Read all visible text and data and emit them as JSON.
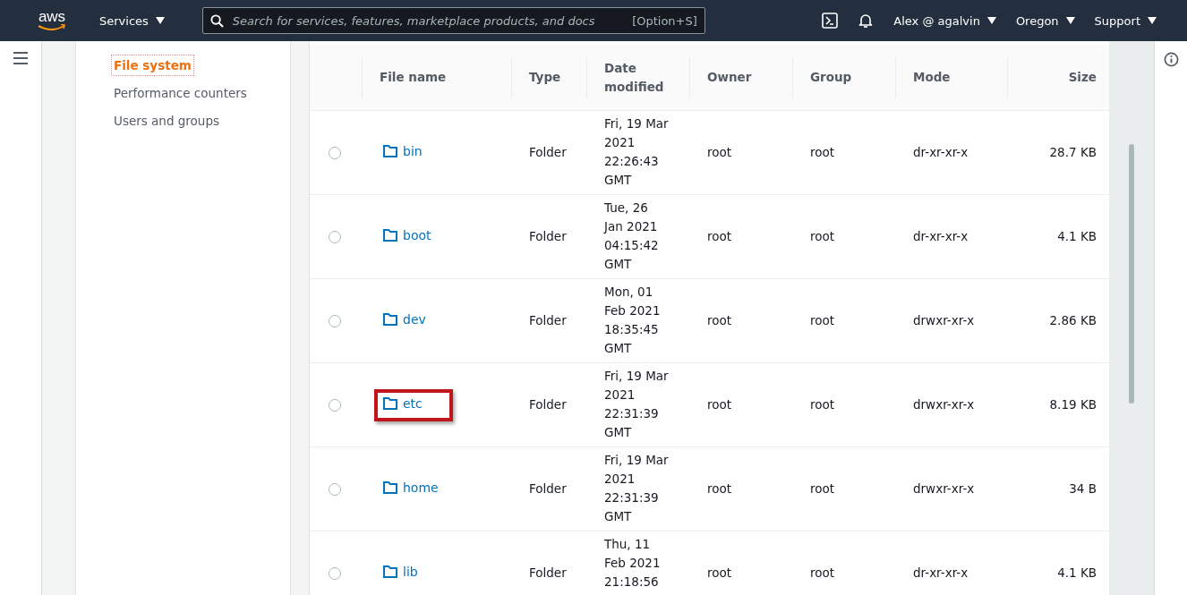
{
  "nav": {
    "logo": "aws",
    "services": "Services",
    "search": {
      "placeholder": "Search for services, features, marketplace products, and docs",
      "shortcut": "[Option+S]"
    },
    "account": "Alex @ agalvin",
    "region": "Oregon",
    "support": "Support"
  },
  "sidebar": {
    "items": [
      {
        "label": "File system",
        "selected": true
      },
      {
        "label": "Performance counters",
        "selected": false
      },
      {
        "label": "Users and groups",
        "selected": false
      }
    ]
  },
  "table": {
    "columns": [
      "File name",
      "Type",
      "Date modified",
      "Owner",
      "Group",
      "Mode",
      "Size"
    ],
    "rows": [
      {
        "selected": false,
        "highlighted": false,
        "name": "bin",
        "type": "Folder",
        "date": [
          "Fri, 19 Mar",
          "2021",
          "22:26:43",
          "GMT"
        ],
        "owner": "root",
        "group": "root",
        "mode": "dr-xr-xr-x",
        "size": "28.7 KB"
      },
      {
        "selected": false,
        "highlighted": false,
        "name": "boot",
        "type": "Folder",
        "date": [
          "Tue, 26",
          "Jan 2021",
          "04:15:42",
          "GMT"
        ],
        "owner": "root",
        "group": "root",
        "mode": "dr-xr-xr-x",
        "size": "4.1 KB"
      },
      {
        "selected": false,
        "highlighted": false,
        "name": "dev",
        "type": "Folder",
        "date": [
          "Mon, 01",
          "Feb 2021",
          "18:35:45",
          "GMT"
        ],
        "owner": "root",
        "group": "root",
        "mode": "drwxr-xr-x",
        "size": "2.86 KB"
      },
      {
        "selected": false,
        "highlighted": true,
        "name": "etc",
        "type": "Folder",
        "date": [
          "Fri, 19 Mar",
          "2021",
          "22:31:39",
          "GMT"
        ],
        "owner": "root",
        "group": "root",
        "mode": "drwxr-xr-x",
        "size": "8.19 KB"
      },
      {
        "selected": false,
        "highlighted": false,
        "name": "home",
        "type": "Folder",
        "date": [
          "Fri, 19 Mar",
          "2021",
          "22:31:39",
          "GMT"
        ],
        "owner": "root",
        "group": "root",
        "mode": "drwxr-xr-x",
        "size": "34 B"
      },
      {
        "selected": false,
        "highlighted": false,
        "name": "lib",
        "type": "Folder",
        "date": [
          "Thu, 11",
          "Feb 2021",
          "21:18:56"
        ],
        "owner": "root",
        "group": "root",
        "mode": "dr-xr-xr-x",
        "size": "4.1 KB"
      }
    ]
  }
}
